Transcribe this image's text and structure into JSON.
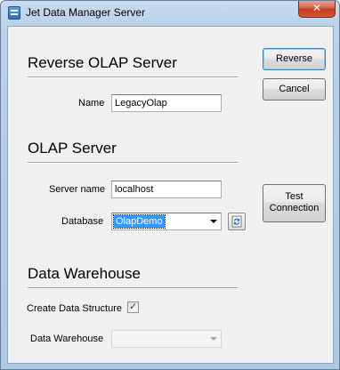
{
  "window": {
    "title": "Jet Data Manager Server",
    "app_icon": "database-server-icon",
    "close_glyph": "✕"
  },
  "reverse_olap": {
    "header": "Reverse OLAP Server",
    "name_label": "Name",
    "name_value": "LegacyOlap"
  },
  "olap": {
    "header": "OLAP Server",
    "server_label": "Server name",
    "server_value": "localhost",
    "database_label": "Database",
    "database_value": "OlapDemo",
    "refresh_icon": "refresh-icon"
  },
  "warehouse": {
    "header": "Data Warehouse",
    "create_label": "Create Data Structure",
    "create_checked": true,
    "checkmark": "✓",
    "dw_label": "Data Warehouse",
    "dw_value": ""
  },
  "buttons": {
    "reverse": "Reverse",
    "cancel": "Cancel",
    "test_line1": "Test",
    "test_line2": "Connection"
  },
  "colors": {
    "selection": "#3399ff",
    "close_red": "#c0391f",
    "frame_blue": "#b9d1ea"
  }
}
